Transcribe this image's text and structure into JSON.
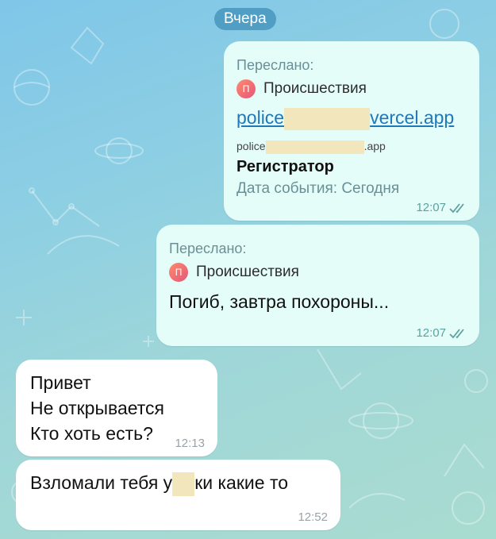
{
  "date_separator": "Вчера",
  "messages": [
    {
      "forwarded_label": "Переслано:",
      "source_name": "Происшествия",
      "source_avatar": "П",
      "link_prefix": "police",
      "link_suffix": "vercel.app",
      "preview_url_prefix": "police",
      "preview_url_suffix": ".app",
      "preview_title": "Регистратор",
      "preview_description": "Дата события: Сегодня",
      "time": "12:07",
      "status": "read"
    },
    {
      "forwarded_label": "Переслано:",
      "source_name": "Происшествия",
      "source_avatar": "П",
      "text": "Погиб, завтра похороны...",
      "time": "12:07",
      "status": "read"
    },
    {
      "lines": [
        "Привет",
        "Не открывается",
        "Кто хоть есть?"
      ],
      "time": "12:13"
    },
    {
      "text_before": "Взломали тебя у",
      "text_after": "ки какие то",
      "time": "12:52"
    }
  ],
  "colors": {
    "outgoing_bubble": "#e4fdf8",
    "incoming_bubble": "#ffffff",
    "link": "#2178b8",
    "date_pill": "#4896be"
  },
  "icons": [
    "double-check-icon",
    "channel-avatar-icon"
  ]
}
